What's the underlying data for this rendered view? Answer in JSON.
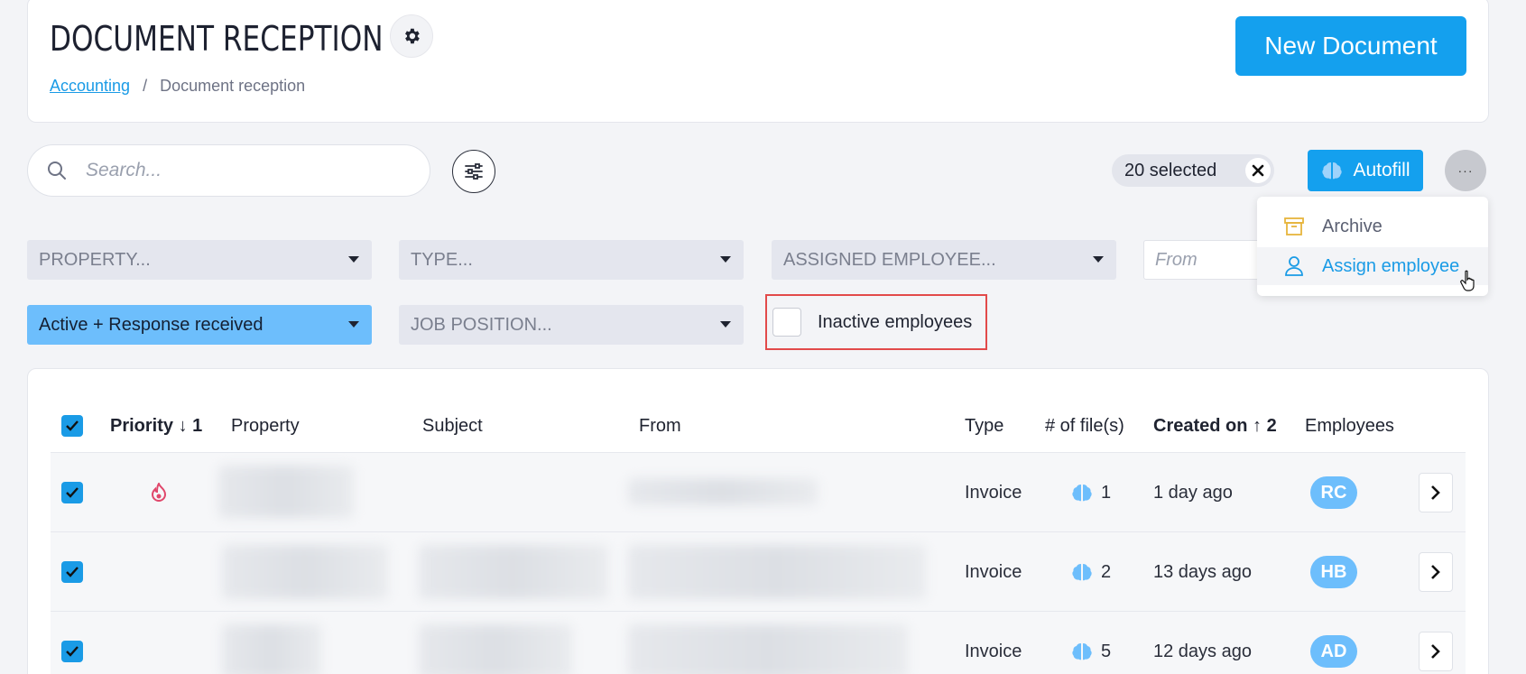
{
  "header": {
    "title": "DOCUMENT RECEPTION",
    "new_document_label": "New Document",
    "breadcrumb": {
      "parent": "Accounting",
      "separator": "/",
      "current": "Document reception"
    }
  },
  "toolbar": {
    "search_placeholder": "Search...",
    "selected_label": "20 selected",
    "autofill_label": "Autofill",
    "more_label": "···"
  },
  "filters": {
    "property": "PROPERTY...",
    "type": "TYPE...",
    "assigned_employee": "ASSIGNED EMPLOYEE...",
    "date_from_placeholder": "From",
    "status": "Active + Response received",
    "job_position": "JOB POSITION...",
    "inactive_employees_label": "Inactive employees"
  },
  "menu": {
    "items": [
      {
        "label": "Archive"
      },
      {
        "label": "Assign employee"
      }
    ]
  },
  "table": {
    "columns": {
      "priority": "Priority ↓ 1",
      "property": "Property",
      "subject": "Subject",
      "from": "From",
      "type": "Type",
      "files": "# of file(s)",
      "created": "Created on ↑ 2",
      "employees": "Employees"
    },
    "rows": [
      {
        "type": "Invoice",
        "files": "1",
        "created": "1 day ago",
        "employee": "RC",
        "priority": true
      },
      {
        "type": "Invoice",
        "files": "2",
        "created": "13 days ago",
        "employee": "HB",
        "priority": false
      },
      {
        "type": "Invoice",
        "files": "5",
        "created": "12 days ago",
        "employee": "AD",
        "priority": false
      }
    ]
  },
  "colors": {
    "accent": "#14a0ee",
    "avatar": "#6dbefc",
    "highlight": "#e24a4a",
    "priority_flame": "#e0476b"
  }
}
